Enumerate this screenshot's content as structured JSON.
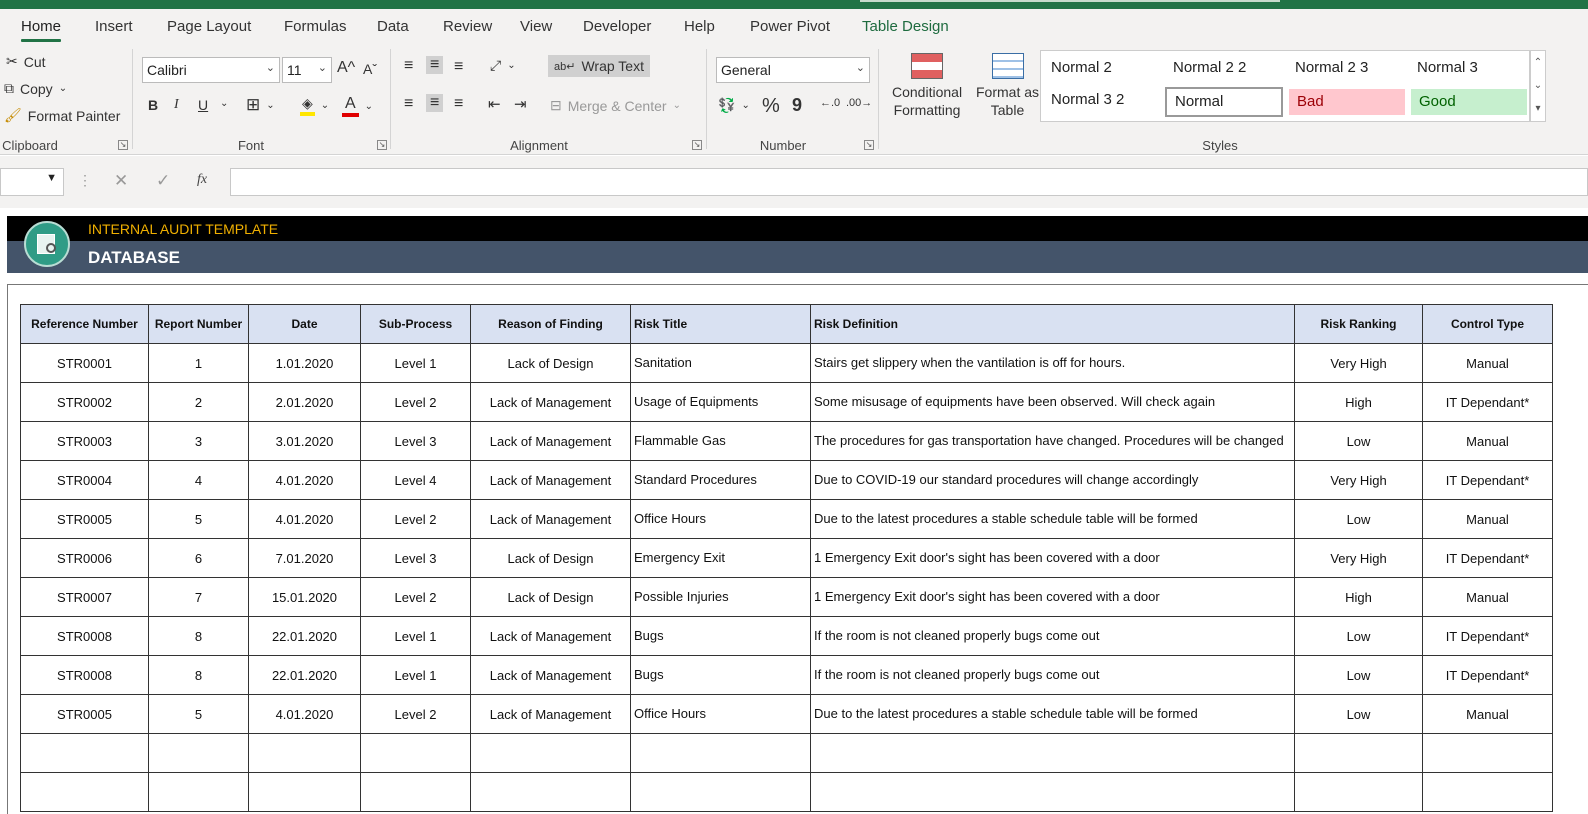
{
  "tabs": [
    "Home",
    "Insert",
    "Page Layout",
    "Formulas",
    "Data",
    "Review",
    "View",
    "Developer",
    "Help",
    "Power Pivot",
    "Table Design"
  ],
  "clipboard": {
    "cut": "Cut",
    "copy": "Copy",
    "format_painter": "Format Painter",
    "label": "Clipboard"
  },
  "font": {
    "name": "Calibri",
    "size": "11",
    "label": "Font",
    "bold": "B",
    "italic": "I",
    "underline": "U"
  },
  "alignment": {
    "wrap_text": "Wrap Text",
    "merge_center": "Merge & Center",
    "label": "Alignment"
  },
  "number": {
    "format": "General",
    "percent": "%",
    "comma": "9",
    "label": "Number"
  },
  "styles_group": {
    "conditional_formatting": "Conditional",
    "conditional_formatting_2": "Formatting",
    "format_as_table": "Format as",
    "format_as_table_2": "Table",
    "cells": [
      "Normal 2",
      "Normal 2 2",
      "Normal 2 3",
      "Normal 3",
      "Normal 3 2",
      "Normal",
      "Bad",
      "Good"
    ],
    "label": "Styles"
  },
  "formula_bar": {
    "fx": "fx",
    "value": ""
  },
  "banner": {
    "subtitle": "INTERNAL AUDIT TEMPLATE",
    "title": "DATABASE"
  },
  "table": {
    "headers": [
      "Reference Number",
      "Report Number",
      "Date",
      "Sub-Process",
      "Reason of Finding",
      "Risk Title",
      "Risk Definition",
      "Risk Ranking",
      "Control Type"
    ],
    "rows": [
      [
        "STR0001",
        "1",
        "1.01.2020",
        "Level 1",
        "Lack of Design",
        "Sanitation",
        "Stairs get slippery when the vantilation is off for hours.",
        "Very High",
        "Manual"
      ],
      [
        "STR0002",
        "2",
        "2.01.2020",
        "Level 2",
        "Lack of Management",
        "Usage of Equipments",
        "Some misusage of equipments have been observed. Will check again",
        "High",
        "IT Dependant*"
      ],
      [
        "STR0003",
        "3",
        "3.01.2020",
        "Level 3",
        "Lack of Management",
        "Flammable Gas",
        "The procedures for gas transportation have changed. Procedures will be changed",
        "Low",
        "Manual"
      ],
      [
        "STR0004",
        "4",
        "4.01.2020",
        "Level 4",
        "Lack of Management",
        "Standard Procedures",
        "Due to COVID-19 our standard procedures will change accordingly",
        "Very High",
        "IT Dependant*"
      ],
      [
        "STR0005",
        "5",
        "4.01.2020",
        "Level 2",
        "Lack of Management",
        "Office Hours",
        "Due to the latest procedures a stable schedule table will be formed",
        "Low",
        "Manual"
      ],
      [
        "STR0006",
        "6",
        "7.01.2020",
        "Level 3",
        "Lack of Design",
        "Emergency Exit",
        "1 Emergency Exit door's sight has been covered with a door",
        "Very High",
        "IT Dependant*"
      ],
      [
        "STR0007",
        "7",
        "15.01.2020",
        "Level 2",
        "Lack of Design",
        "Possible Injuries",
        "1 Emergency Exit door's sight has been covered with a door",
        "High",
        "Manual"
      ],
      [
        "STR0008",
        "8",
        "22.01.2020",
        "Level 1",
        "Lack of Management",
        "Bugs",
        "If the room is not cleaned properly bugs come out",
        "Low",
        "IT Dependant*"
      ],
      [
        "STR0008",
        "8",
        "22.01.2020",
        "Level 1",
        "Lack of Management",
        "Bugs",
        "If the room is not cleaned properly bugs come out",
        "Low",
        "IT Dependant*"
      ],
      [
        "STR0005",
        "5",
        "4.01.2020",
        "Level 2",
        "Lack of Management",
        "Office Hours",
        "Due to the latest procedures a stable schedule table will be formed",
        "Low",
        "Manual"
      ],
      [
        "",
        "",
        "",
        "",
        "",
        "",
        "",
        "",
        ""
      ],
      [
        "",
        "",
        "",
        "",
        "",
        "",
        "",
        "",
        ""
      ]
    ]
  },
  "colors": {
    "accent": "#217346",
    "banner_text": "#f0b000",
    "banner_bg": "#44546a",
    "header_bg": "#d9e1f2",
    "bad_bg": "#ffc7ce",
    "good_bg": "#c6efce"
  }
}
